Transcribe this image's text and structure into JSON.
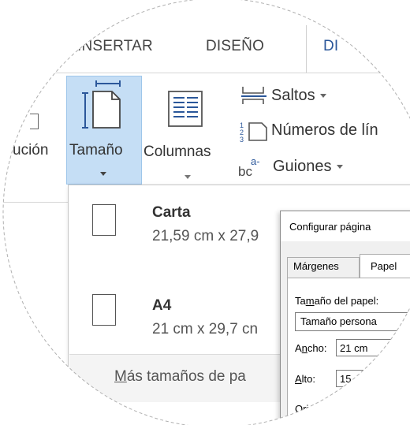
{
  "ribbon": {
    "tabs": [
      {
        "label": "INSERTAR",
        "active": false
      },
      {
        "label": "DISEÑO",
        "active": false
      },
      {
        "label": "DI",
        "active": true
      }
    ],
    "left_partial_label": "ución",
    "tamano_label": "Tamaño",
    "columnas_label": "Columnas",
    "saltos_label": "Saltos",
    "numeros_label": "Números de lín",
    "guiones_label": "Guiones"
  },
  "size_menu": {
    "items": [
      {
        "name": "Carta",
        "dimensions": "21,59 cm x 27,9"
      },
      {
        "name": "A4",
        "dimensions": "21 cm x 29,7 cn"
      }
    ],
    "more_label_access_key": "M",
    "more_label_rest": "ás tamaños de pa"
  },
  "dialog": {
    "title": "Configurar página",
    "tabs": [
      "Márgenes",
      "Papel"
    ],
    "paper_size_label_pre": "Ta",
    "paper_size_label_key": "m",
    "paper_size_label_post": "año del papel:",
    "paper_size_value": "Tamaño persona",
    "width_label_pre": "A",
    "width_label_key": "n",
    "width_label_post": "cho:",
    "width_value": "21 cm",
    "height_label_pre": "",
    "height_label_key": "A",
    "height_label_post": "lto:",
    "height_value": "15",
    "paper_source_label": "Origen del papel"
  },
  "colors": {
    "accent": "#2b579a",
    "selected_bg": "#c5def5"
  }
}
